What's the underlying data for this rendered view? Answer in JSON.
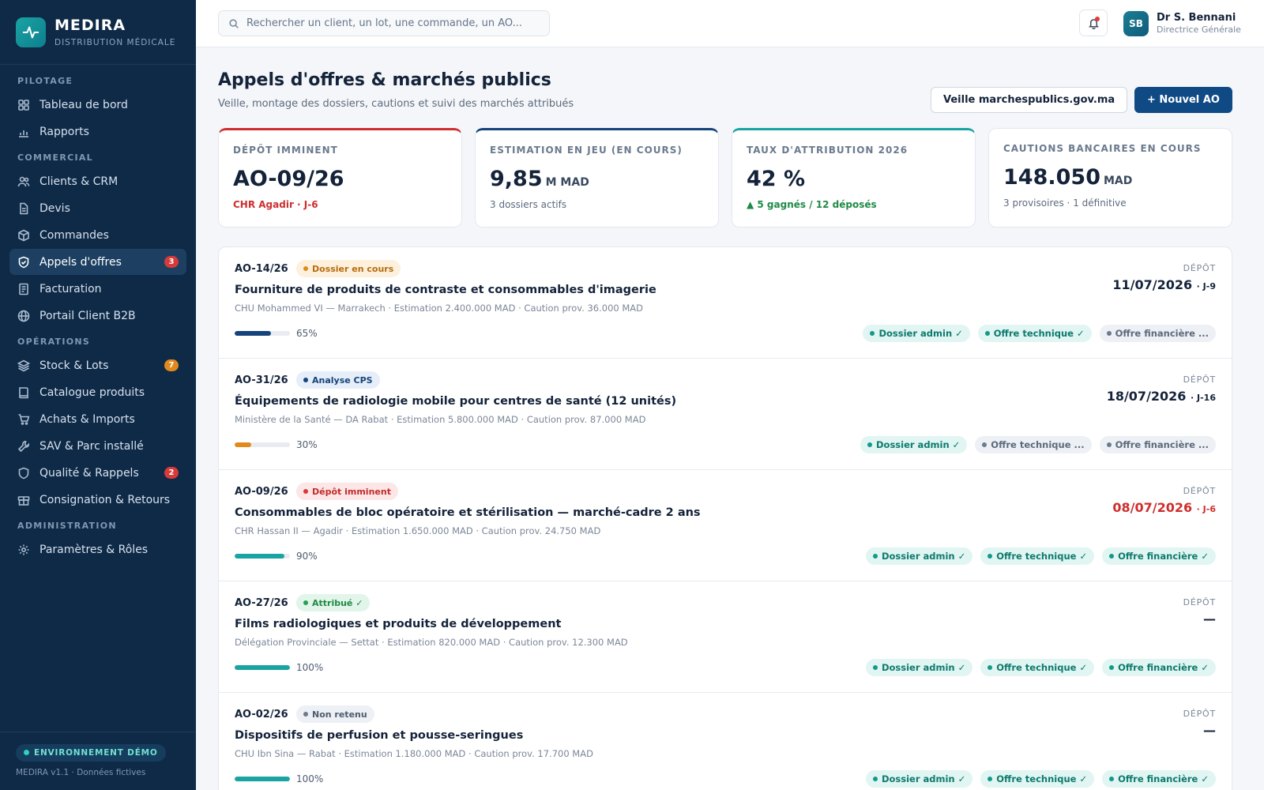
{
  "brand": {
    "name": "MEDIRA",
    "subtitle": "DISTRIBUTION MÉDICALE"
  },
  "sidebar": {
    "sections": [
      {
        "title": "PILOTAGE",
        "items": [
          {
            "label": "Tableau de bord",
            "icon": "grid-icon"
          },
          {
            "label": "Rapports",
            "icon": "bar-chart-icon"
          }
        ]
      },
      {
        "title": "COMMERCIAL",
        "items": [
          {
            "label": "Clients & CRM",
            "icon": "users-icon"
          },
          {
            "label": "Devis",
            "icon": "file-text-icon"
          },
          {
            "label": "Commandes",
            "icon": "box-icon"
          },
          {
            "label": "Appels d'offres",
            "icon": "shield-check-icon",
            "active": true,
            "badge": "3"
          },
          {
            "label": "Facturation",
            "icon": "receipt-icon"
          },
          {
            "label": "Portail Client B2B",
            "icon": "globe-icon"
          }
        ]
      },
      {
        "title": "OPÉRATIONS",
        "items": [
          {
            "label": "Stock & Lots",
            "icon": "layers-icon",
            "badge": "7"
          },
          {
            "label": "Catalogue produits",
            "icon": "book-icon"
          },
          {
            "label": "Achats & Imports",
            "icon": "cart-icon"
          },
          {
            "label": "SAV & Parc installé",
            "icon": "wrench-icon"
          },
          {
            "label": "Qualité & Rappels",
            "icon": "shield-icon",
            "badge": "2"
          },
          {
            "label": "Consignation & Retours",
            "icon": "package-icon"
          }
        ]
      },
      {
        "title": "ADMINISTRATION",
        "items": [
          {
            "label": "Paramètres & Rôles",
            "icon": "gear-icon"
          }
        ]
      }
    ],
    "env": "ENVIRONNEMENT DÉMO",
    "version": "MEDIRA v1.1 · Données fictives"
  },
  "topbar": {
    "search_placeholder": "Rechercher un client, un lot, une commande, un AO...",
    "user": {
      "initials": "SB",
      "name": "Dr S. Bennani",
      "role": "Directrice Générale"
    }
  },
  "page": {
    "title": "Appels d'offres & marchés publics",
    "subtitle": "Veille, montage des dossiers, cautions et suivi des marchés attribués",
    "btn_watch": "Veille marchespublics.gov.ma",
    "btn_new": "+ Nouvel AO"
  },
  "kpis": [
    {
      "label": "DÉPÔT IMMINENT",
      "value": "AO-09/26",
      "unit": "",
      "sub": "CHR Agadir · J-6"
    },
    {
      "label": "ESTIMATION EN JEU (EN COURS)",
      "value": "9,85",
      "unit": "M MAD",
      "sub": "3 dossiers actifs"
    },
    {
      "label": "TAUX D'ATTRIBUTION 2026",
      "value": "42 %",
      "unit": "",
      "sub": "▲ 5 gagnés / 12 déposés"
    },
    {
      "label": "CAUTIONS BANCAIRES EN COURS",
      "value": "148.050",
      "unit": "MAD",
      "sub": "3 provisoires · 1 définitive"
    }
  ],
  "depot_label": "DÉPÔT",
  "tenders": [
    {
      "ref": "AO-14/26",
      "status": "Dossier en cours",
      "status_color": "#e08a1e",
      "title": "Fourniture de produits de contraste et consommables d'imagerie",
      "meta": "CHU Mohammed VI — Marrakech · Estimation 2.400.000 MAD · Caution prov. 36.000 MAD",
      "progress": 65,
      "progress_label": "65%",
      "progress_color": "#15437a",
      "date": "11/07/2026",
      "j": "· J-9",
      "tags": [
        {
          "label": "Dossier admin ✓",
          "done": true
        },
        {
          "label": "Offre technique ✓",
          "done": true
        },
        {
          "label": "Offre financière ...",
          "done": false
        }
      ]
    },
    {
      "ref": "AO-31/26",
      "status": "Analyse CPS",
      "status_color": "#15437a",
      "title": "Équipements de radiologie mobile pour centres de santé (12 unités)",
      "meta": "Ministère de la Santé — DA Rabat · Estimation 5.800.000 MAD · Caution prov. 87.000 MAD",
      "progress": 30,
      "progress_label": "30%",
      "progress_color": "#e08a1e",
      "date": "18/07/2026",
      "j": "· J-16",
      "tags": [
        {
          "label": "Dossier admin ✓",
          "done": true
        },
        {
          "label": "Offre technique ...",
          "done": false
        },
        {
          "label": "Offre financière ...",
          "done": false
        }
      ]
    },
    {
      "ref": "AO-09/26",
      "status": "Dépôt imminent",
      "status_color": "#d63a3a",
      "title": "Consommables de bloc opératoire et stérilisation — marché-cadre 2 ans",
      "meta": "CHR Hassan II — Agadir · Estimation 1.650.000 MAD · Caution prov. 24.750 MAD",
      "progress": 90,
      "progress_label": "90%",
      "progress_color": "#1aa3a3",
      "date": "08/07/2026",
      "j": "· J-6",
      "tags": [
        {
          "label": "Dossier admin ✓",
          "done": true
        },
        {
          "label": "Offre technique ✓",
          "done": true
        },
        {
          "label": "Offre financière ✓",
          "done": true
        }
      ]
    },
    {
      "ref": "AO-27/26",
      "status": "Attribué ✓",
      "status_color": "#24a152",
      "title": "Films radiologiques et produits de développement",
      "meta": "Délégation Provinciale — Settat · Estimation 820.000 MAD · Caution prov. 12.300 MAD",
      "progress": 100,
      "progress_label": "100%",
      "progress_color": "#1aa3a3",
      "date": "—",
      "j": "",
      "tags": [
        {
          "label": "Dossier admin ✓",
          "done": true
        },
        {
          "label": "Offre technique ✓",
          "done": true
        },
        {
          "label": "Offre financière ✓",
          "done": true
        }
      ]
    },
    {
      "ref": "AO-02/26",
      "status": "Non retenu",
      "status_color": "#6b7a8e",
      "title": "Dispositifs de perfusion et pousse-seringues",
      "meta": "CHU Ibn Sina — Rabat · Estimation 1.180.000 MAD · Caution prov. 17.700 MAD",
      "progress": 100,
      "progress_label": "100%",
      "progress_color": "#1aa3a3",
      "date": "—",
      "j": "",
      "tags": [
        {
          "label": "Dossier admin ✓",
          "done": true
        },
        {
          "label": "Offre technique ✓",
          "done": true
        },
        {
          "label": "Offre financière ✓",
          "done": true
        }
      ]
    }
  ]
}
